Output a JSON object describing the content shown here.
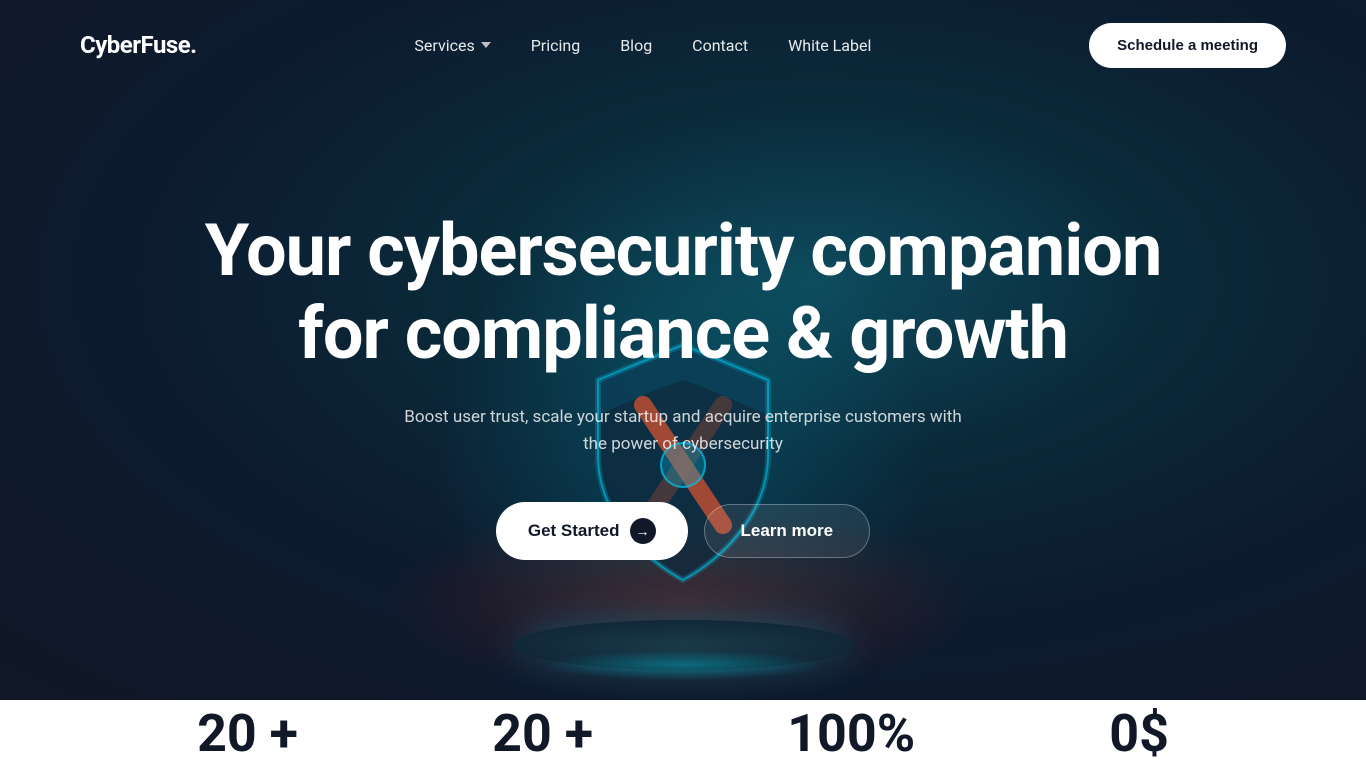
{
  "navbar": {
    "logo": "CyberFuse.",
    "nav": [
      {
        "label": "Services",
        "has_dropdown": true,
        "id": "services"
      },
      {
        "label": "Pricing",
        "has_dropdown": false,
        "id": "pricing"
      },
      {
        "label": "Blog",
        "has_dropdown": false,
        "id": "blog"
      },
      {
        "label": "Contact",
        "has_dropdown": false,
        "id": "contact"
      },
      {
        "label": "White Label",
        "has_dropdown": false,
        "id": "white-label"
      }
    ],
    "cta_button": "Schedule a meeting"
  },
  "hero": {
    "title": "Your cybersecurity companion for compliance & growth",
    "subtitle": "Boost user trust, scale your startup and acquire enterprise customers with the power of cybersecurity",
    "btn_get_started": "Get Started",
    "btn_learn_more": "Learn more"
  },
  "stats": [
    {
      "value": "20 +"
    },
    {
      "value": "20 +"
    },
    {
      "value": "100%"
    },
    {
      "value": "0$"
    }
  ],
  "colors": {
    "hero_bg_start": "#0d4a5c",
    "hero_bg_end": "#111827",
    "accent": "#00b4d8",
    "white": "#ffffff",
    "dark": "#111827"
  }
}
